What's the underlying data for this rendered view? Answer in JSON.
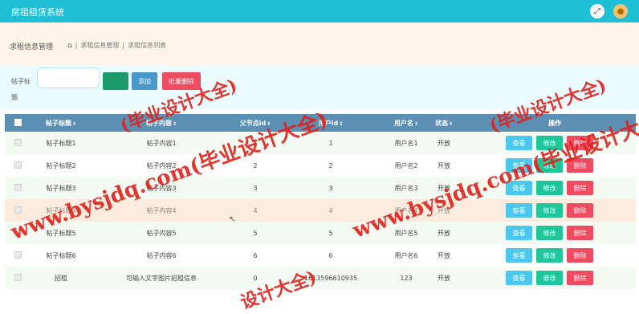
{
  "header": {
    "title": "房租租赁系统",
    "fullscreen_icon": "expand-icon",
    "avatar_icon": "user-avatar-icon",
    "accent": "#1fbfd6"
  },
  "crumbs": {
    "section": "求租信息管理",
    "items": [
      "求租信息管理",
      "求租信息列表"
    ]
  },
  "search": {
    "label": "帖子标题",
    "value": "",
    "placeholder": "",
    "search_label": "",
    "add_label": "添加",
    "batch_delete_label": "批量删除"
  },
  "table": {
    "headers": {
      "title": "帖子标题",
      "content": "帖子内容",
      "parent": "父节点id",
      "user_id": "用户id",
      "username": "用户名",
      "status": "状态",
      "ops": "操作"
    },
    "rows": [
      {
        "title": "帖子标题1",
        "content": "帖子内容1",
        "parent": "1",
        "user_id": "1",
        "username": "用户名1",
        "status": "开放"
      },
      {
        "title": "帖子标题2",
        "content": "帖子内容2",
        "parent": "2",
        "user_id": "2",
        "username": "用户名2",
        "status": "开放"
      },
      {
        "title": "帖子标题3",
        "content": "帖子内容3",
        "parent": "3",
        "user_id": "3",
        "username": "用户名3",
        "status": "开放"
      },
      {
        "title": "帖子标题4",
        "content": "帖子内容4",
        "parent": "4",
        "user_id": "4",
        "username": "用户名4",
        "status": "开放"
      },
      {
        "title": "帖子标题5",
        "content": "帖子内容5",
        "parent": "5",
        "user_id": "5",
        "username": "用户名5",
        "status": "开放"
      },
      {
        "title": "帖子标题6",
        "content": "帖子内容6",
        "parent": "6",
        "user_id": "6",
        "username": "用户名6",
        "status": "开放"
      },
      {
        "title": "招租",
        "content": "可输入文字图片招租信息",
        "parent": "0",
        "user_id": "1613596610935",
        "username": "123",
        "status": "开放"
      }
    ],
    "op_labels": {
      "view": "查看",
      "edit": "修改",
      "delete": "删除"
    }
  },
  "watermark": {
    "text1": "www.bysjdq.com(毕业设计大全)",
    "text2": "www.bysjdq.com(毕业设计大全)",
    "text3": "(毕业设计大全)",
    "text4": "(毕业设计大全)",
    "text5": "设计大全)"
  }
}
